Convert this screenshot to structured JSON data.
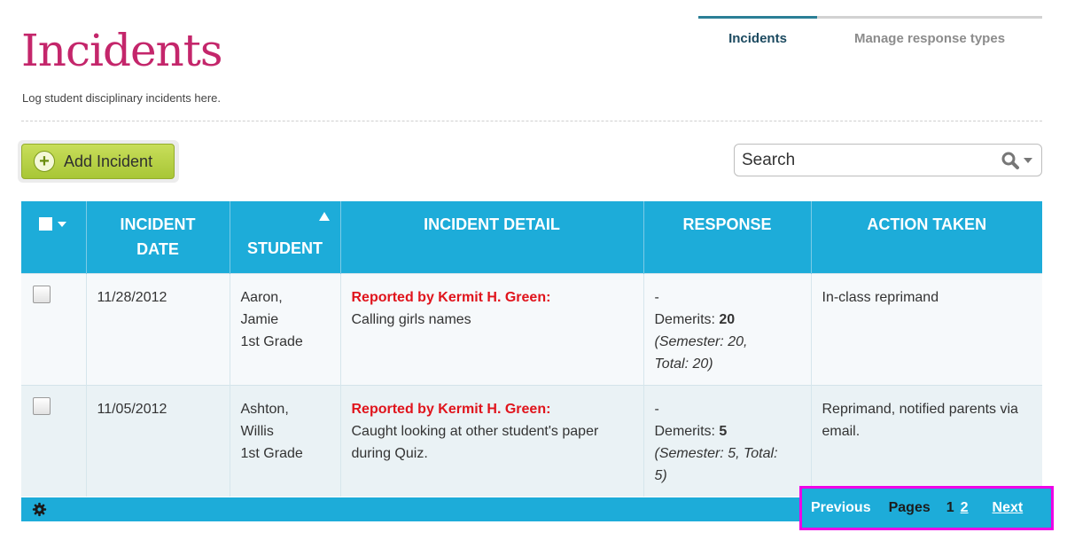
{
  "page": {
    "title": "Incidents",
    "subtitle": "Log student disciplinary incidents here."
  },
  "tabs": [
    {
      "label": "Incidents",
      "active": true
    },
    {
      "label": "Manage response types",
      "active": false
    }
  ],
  "toolbar": {
    "add_label": "Add Incident",
    "search_placeholder": "Search",
    "search_icon": "search-icon",
    "accent": "#1dacd9"
  },
  "table": {
    "headers": {
      "incident_date_line1": "INCIDENT",
      "incident_date_line2": "DATE",
      "student": "STUDENT",
      "incident_detail": "INCIDENT DETAIL",
      "response": "RESPONSE",
      "action_taken": "ACTION TAKEN"
    },
    "sort": {
      "column": "student",
      "direction": "ascending"
    },
    "rows": [
      {
        "date": "11/28/2012",
        "student_name_line1": "Aaron,",
        "student_name_line2": "Jamie",
        "grade": "1st Grade",
        "reporter": "Reported by Kermit H. Green:",
        "detail": "Calling girls names",
        "response_dash": "-",
        "demerits_label": "Demerits:",
        "demerits_value": "20",
        "semester_line1": "(Semester: 20,",
        "semester_line2": "Total: 20)",
        "action": "In-class reprimand"
      },
      {
        "date": "11/05/2012",
        "student_name_line1": "Ashton,",
        "student_name_line2": "Willis",
        "grade": "1st Grade",
        "reporter": "Reported by Kermit H. Green:",
        "detail": "Caught looking at other student's paper during Quiz.",
        "response_dash": "-",
        "demerits_label": "Demerits:",
        "demerits_value": "5",
        "semester_line1": "(Semester: 5, Total:",
        "semester_line2": "5)",
        "action": "Reprimand, notified parents via email."
      }
    ]
  },
  "pager": {
    "previous": "Previous",
    "pages_label": "Pages",
    "pages": [
      "1",
      "2"
    ],
    "current_page": "1",
    "next": "Next"
  },
  "colors": {
    "title": "#c4266b",
    "header_bg": "#1dacd9",
    "reporter": "#e0141c",
    "add_button": "#b5d143",
    "highlight": "#ee00e6"
  }
}
